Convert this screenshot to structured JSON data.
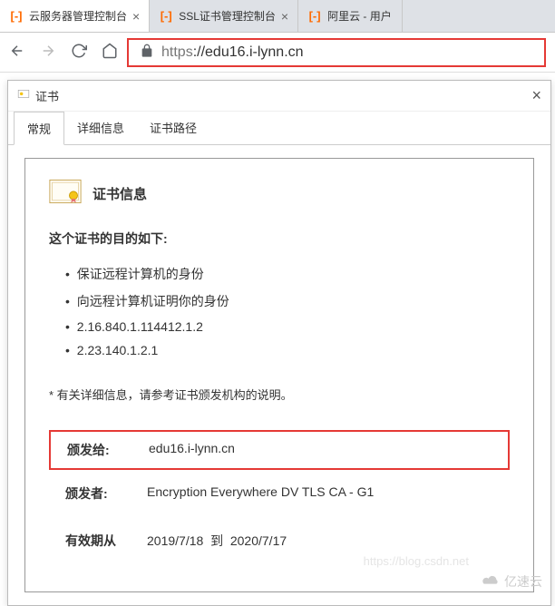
{
  "browser": {
    "tabs": [
      {
        "title": "云服务器管理控制台"
      },
      {
        "title": "SSL证书管理控制台"
      },
      {
        "title": "阿里云 - 用户"
      }
    ],
    "url_scheme": "https",
    "url_host": "://edu16.i-lynn.cn"
  },
  "dialog": {
    "title": "证书",
    "tabs": {
      "general": "常规",
      "details": "详细信息",
      "certpath": "证书路径"
    },
    "info_header": "证书信息",
    "purpose_title": "这个证书的目的如下:",
    "purposes": [
      "保证远程计算机的身份",
      "向远程计算机证明你的身份",
      "2.16.840.1.114412.1.2",
      "2.23.140.1.2.1"
    ],
    "note_prefix": "* 有关详细信息，请参考证书颁发机构的说明。",
    "issued_to_label": "颁发给:",
    "issued_to_value": "edu16.i-lynn.cn",
    "issuer_label": "颁发者:",
    "issuer_value": "Encryption Everywhere DV TLS CA - G1",
    "valid_label": "有效期从",
    "valid_from": "2019/7/18",
    "valid_to_word": "到",
    "valid_to": "2020/7/17"
  },
  "watermark": {
    "text": "亿速云",
    "url": "https://blog.csdn.net"
  }
}
